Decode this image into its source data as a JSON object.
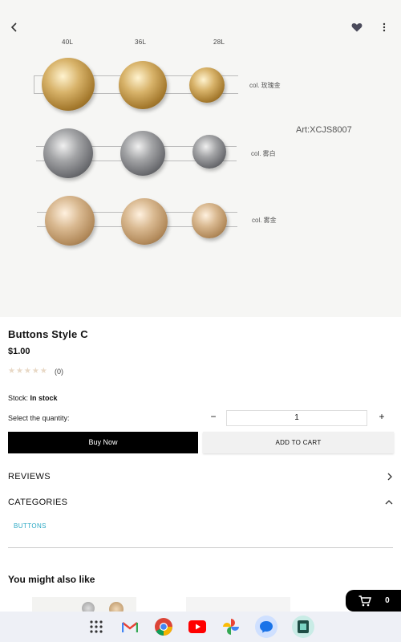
{
  "hero": {
    "sizes": [
      "40L",
      "36L",
      "28L"
    ],
    "colors": [
      "col. 玫瑰金",
      "col. 雾白",
      "col. 雾金"
    ],
    "art_code": "Art:XCJS8007"
  },
  "product": {
    "title": "Buttons Style C",
    "price": "$1.00",
    "stars": "★★★★★",
    "rating_count": "(0)",
    "stock_label": "Stock:",
    "stock_value": "In stock",
    "quantity_label": "Select the quantity:",
    "quantity_value": "1",
    "minus": "−",
    "plus": "+"
  },
  "actions": {
    "buy_now": "Buy Now",
    "add_to_cart": "ADD TO CART"
  },
  "sections": {
    "reviews": "REVIEWS",
    "categories": "CATEGORIES",
    "category_link": "BUTTONS"
  },
  "related": {
    "title": "You might also like"
  },
  "cart": {
    "count": "0"
  },
  "colors": {
    "accent_link": "#2aa8c4",
    "rose_gold": "#c79a4e",
    "gunmetal": "#7c7d80",
    "champagne": "#c9a77a"
  },
  "icons": [
    "back-icon",
    "heart-icon",
    "more-vert-icon",
    "cart-icon",
    "chevron-right-icon",
    "chevron-up-icon",
    "apps-grid-icon",
    "gmail-icon",
    "chrome-icon",
    "youtube-icon",
    "photos-icon",
    "messages-icon",
    "wallet-icon"
  ]
}
